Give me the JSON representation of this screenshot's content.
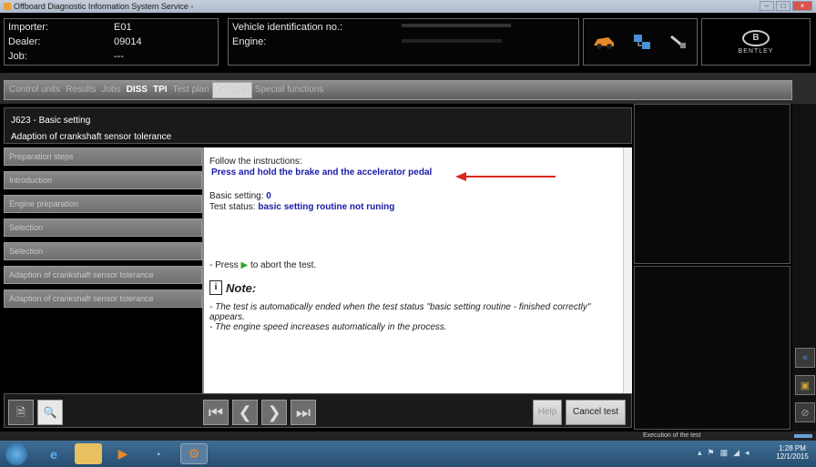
{
  "window": {
    "title": "Offboard Diagnostic Information System Service -",
    "min": "–",
    "max": "□",
    "close": "×"
  },
  "header": {
    "importer_label": "Importer:",
    "importer_value": "E01",
    "dealer_label": "Dealer:",
    "dealer_value": "09014",
    "job_label": "Job:",
    "job_value": "---",
    "vin_label": "Vehicle identification no.:",
    "engine_label": "Engine:",
    "brand": "BENTLEY",
    "brand_mark": "B"
  },
  "tabs": [
    {
      "label": "Control units"
    },
    {
      "label": "Results"
    },
    {
      "label": "Jobs"
    },
    {
      "label": "DISS"
    },
    {
      "label": "TPI"
    },
    {
      "label": "Test plan"
    },
    {
      "label": "Process"
    },
    {
      "label": "Special functions"
    }
  ],
  "module": {
    "title": "J623 - Basic setting",
    "subtitle": "Adaption of crankshaft sensor tolerance"
  },
  "steps": [
    "Preparation steps",
    "Introduction",
    "Engine preparation",
    "Selection",
    "Selection",
    "Adaption of crankshaft sensor tolerance",
    "Adaption of crankshaft sensor tolerance"
  ],
  "content": {
    "follow": "Follow the instructions:",
    "instruction": "Press and hold the brake and the accelerator pedal",
    "basic_label": "Basic setting:",
    "basic_value": "0",
    "status_label": "Test status:",
    "status_value": "basic setting routine not runing",
    "press_pre": "- Press",
    "press_post": "to abort the test.",
    "note_title": "Note:",
    "note1": "- The test is automatically ended when the test status \"basic setting routine - finished correctly\"",
    "note1b": "appears.",
    "note2": "- The engine speed increases automatically in the process."
  },
  "buttons": {
    "help": "Help",
    "cancel": "Cancel test"
  },
  "status_text": "Execution of the test",
  "tray": {
    "time": "1:28 PM",
    "date": "12/1/2015"
  },
  "colors": {
    "accent_arrow": "#d9281f",
    "instruction_blue": "#1a1aa8"
  }
}
